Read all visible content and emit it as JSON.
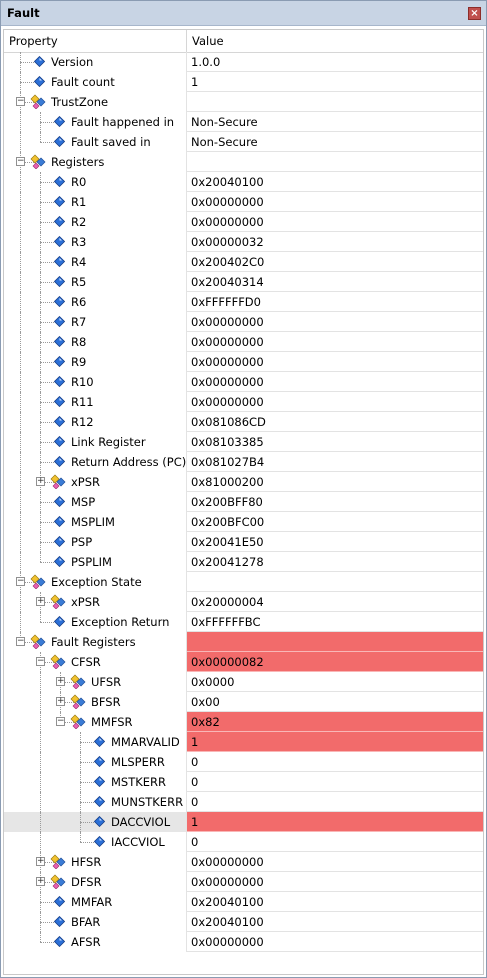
{
  "window": {
    "title": "Fault"
  },
  "grid": {
    "header_property": "Property",
    "header_value": "Value"
  },
  "rows": [
    {
      "label": "Version",
      "value": "1.0.0",
      "depth": 0,
      "kind": "leaf"
    },
    {
      "label": "Fault count",
      "value": "1",
      "depth": 0,
      "kind": "leaf"
    },
    {
      "label": "TrustZone",
      "value": "",
      "depth": 0,
      "kind": "group",
      "expanded": true
    },
    {
      "label": "Fault happened in",
      "value": "Non-Secure",
      "depth": 1,
      "kind": "leaf"
    },
    {
      "label": "Fault saved in",
      "value": "Non-Secure",
      "depth": 1,
      "kind": "leaf"
    },
    {
      "label": "Registers",
      "value": "",
      "depth": 0,
      "kind": "group",
      "expanded": true
    },
    {
      "label": "R0",
      "value": "0x20040100",
      "depth": 1,
      "kind": "leaf"
    },
    {
      "label": "R1",
      "value": "0x00000000",
      "depth": 1,
      "kind": "leaf"
    },
    {
      "label": "R2",
      "value": "0x00000000",
      "depth": 1,
      "kind": "leaf"
    },
    {
      "label": "R3",
      "value": "0x00000032",
      "depth": 1,
      "kind": "leaf"
    },
    {
      "label": "R4",
      "value": "0x200402C0",
      "depth": 1,
      "kind": "leaf"
    },
    {
      "label": "R5",
      "value": "0x20040314",
      "depth": 1,
      "kind": "leaf"
    },
    {
      "label": "R6",
      "value": "0xFFFFFFD0",
      "depth": 1,
      "kind": "leaf"
    },
    {
      "label": "R7",
      "value": "0x00000000",
      "depth": 1,
      "kind": "leaf"
    },
    {
      "label": "R8",
      "value": "0x00000000",
      "depth": 1,
      "kind": "leaf"
    },
    {
      "label": "R9",
      "value": "0x00000000",
      "depth": 1,
      "kind": "leaf"
    },
    {
      "label": "R10",
      "value": "0x00000000",
      "depth": 1,
      "kind": "leaf"
    },
    {
      "label": "R11",
      "value": "0x00000000",
      "depth": 1,
      "kind": "leaf"
    },
    {
      "label": "R12",
      "value": "0x081086CD",
      "depth": 1,
      "kind": "leaf"
    },
    {
      "label": "Link Register",
      "value": "0x08103385",
      "depth": 1,
      "kind": "leaf"
    },
    {
      "label": "Return Address (PC)",
      "value": "0x081027B4",
      "depth": 1,
      "kind": "leaf"
    },
    {
      "label": "xPSR",
      "value": "0x81000200",
      "depth": 1,
      "kind": "group",
      "expanded": false
    },
    {
      "label": "MSP",
      "value": "0x200BFF80",
      "depth": 1,
      "kind": "leaf"
    },
    {
      "label": "MSPLIM",
      "value": "0x200BFC00",
      "depth": 1,
      "kind": "leaf"
    },
    {
      "label": "PSP",
      "value": "0x20041E50",
      "depth": 1,
      "kind": "leaf"
    },
    {
      "label": "PSPLIM",
      "value": "0x20041278",
      "depth": 1,
      "kind": "leaf"
    },
    {
      "label": "Exception State",
      "value": "",
      "depth": 0,
      "kind": "group",
      "expanded": true
    },
    {
      "label": "xPSR",
      "value": "0x20000004",
      "depth": 1,
      "kind": "group",
      "expanded": false
    },
    {
      "label": "Exception Return",
      "value": "0xFFFFFFBC",
      "depth": 1,
      "kind": "leaf"
    },
    {
      "label": "Fault Registers",
      "value": "",
      "depth": 0,
      "kind": "group",
      "expanded": true,
      "highlight": true
    },
    {
      "label": "CFSR",
      "value": "0x00000082",
      "depth": 1,
      "kind": "group",
      "expanded": true,
      "highlight": true
    },
    {
      "label": "UFSR",
      "value": "0x0000",
      "depth": 2,
      "kind": "group",
      "expanded": false
    },
    {
      "label": "BFSR",
      "value": "0x00",
      "depth": 2,
      "kind": "group",
      "expanded": false
    },
    {
      "label": "MMFSR",
      "value": "0x82",
      "depth": 2,
      "kind": "group",
      "expanded": true,
      "highlight": true
    },
    {
      "label": "MMARVALID",
      "value": "1",
      "depth": 3,
      "kind": "leaf",
      "highlight": true
    },
    {
      "label": "MLSPERR",
      "value": "0",
      "depth": 3,
      "kind": "leaf"
    },
    {
      "label": "MSTKERR",
      "value": "0",
      "depth": 3,
      "kind": "leaf"
    },
    {
      "label": "MUNSTKERR",
      "value": "0",
      "depth": 3,
      "kind": "leaf"
    },
    {
      "label": "DACCVIOL",
      "value": "1",
      "depth": 3,
      "kind": "leaf",
      "highlight": true,
      "selected": true
    },
    {
      "label": "IACCVIOL",
      "value": "0",
      "depth": 3,
      "kind": "leaf"
    },
    {
      "label": "HFSR",
      "value": "0x00000000",
      "depth": 1,
      "kind": "group",
      "expanded": false
    },
    {
      "label": "DFSR",
      "value": "0x00000000",
      "depth": 1,
      "kind": "group",
      "expanded": false
    },
    {
      "label": "MMFAR",
      "value": "0x20040100",
      "depth": 1,
      "kind": "leaf"
    },
    {
      "label": "BFAR",
      "value": "0x20040100",
      "depth": 1,
      "kind": "leaf"
    },
    {
      "label": "AFSR",
      "value": "0x00000000",
      "depth": 1,
      "kind": "leaf"
    }
  ],
  "colors": {
    "highlight": "#f26b6b",
    "titlebar": "#c8d4e4",
    "leaf_icon": "#2b6fd6",
    "group_icon_yellow": "#f2c230",
    "group_icon_blue": "#3a7bd5"
  },
  "icons": {
    "leaf": "blue-diamond-icon",
    "group": "register-group-icon",
    "close": "close-icon",
    "expand": "plus-box-icon",
    "collapse": "minus-box-icon"
  }
}
